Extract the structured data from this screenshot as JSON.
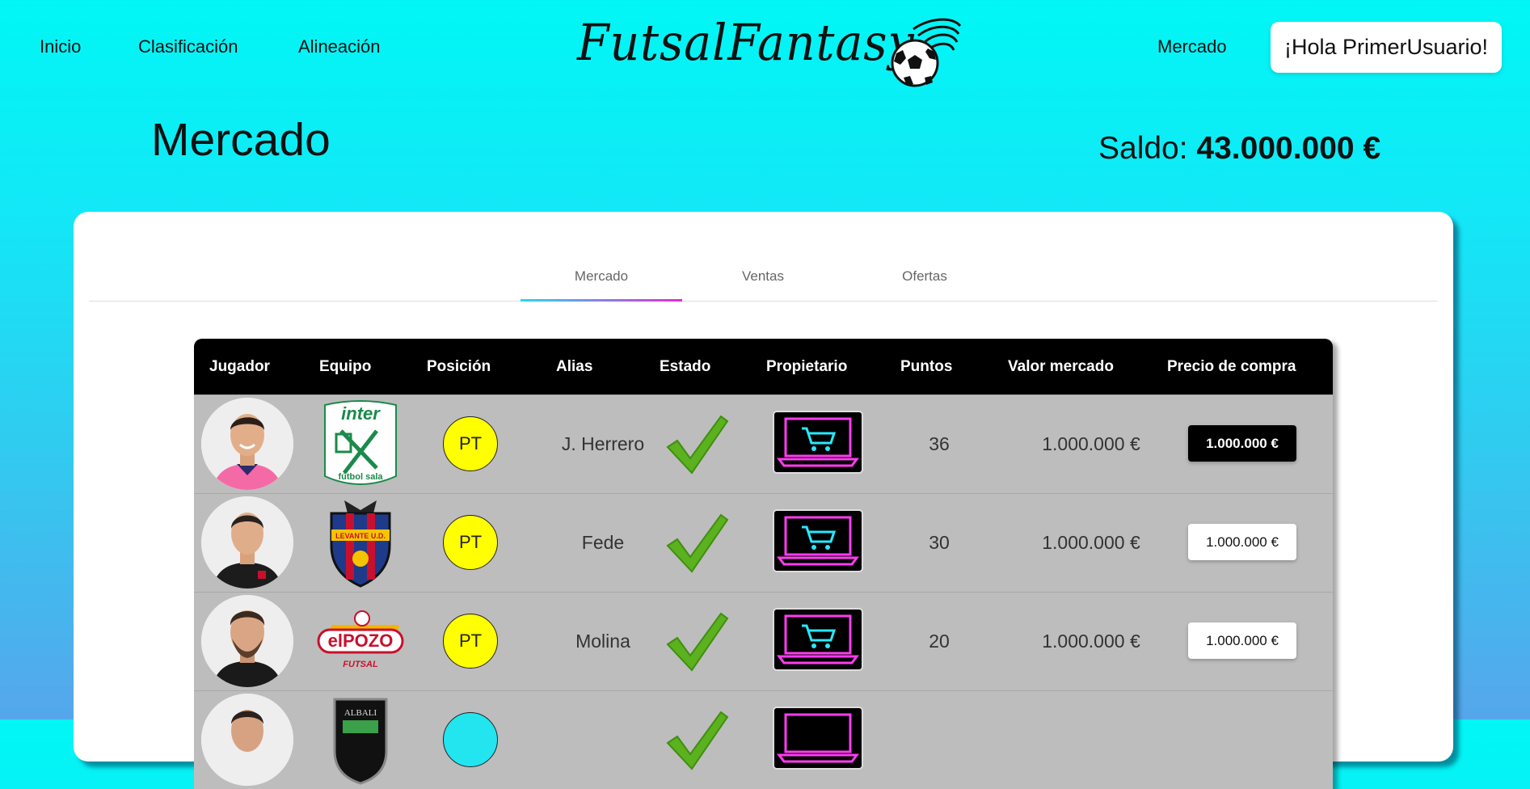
{
  "nav": {
    "inicio": "Inicio",
    "clasificacion": "Clasificación",
    "alineacion": "Alineación",
    "mercado": "Mercado",
    "user_greeting": "¡Hola PrimerUsuario!"
  },
  "logo": {
    "text": "FutsalFantasy"
  },
  "header": {
    "title": "Mercado",
    "saldo_label": "Saldo: ",
    "saldo_value": "43.000.000 €"
  },
  "tabs": [
    {
      "label": "Mercado",
      "active": true
    },
    {
      "label": "Ventas",
      "active": false
    },
    {
      "label": "Ofertas",
      "active": false
    }
  ],
  "table": {
    "headers": [
      "Jugador",
      "Equipo",
      "Posición",
      "Alias",
      "Estado",
      "Propietario",
      "Puntos",
      "Valor mercado",
      "Precio de compra"
    ],
    "rows": [
      {
        "team_icon": "inter-futbol-sala-crest",
        "position": "PT",
        "alias": "J. Herrero",
        "status_icon": "check-icon",
        "owner_icon": "market-laptop-icon",
        "points": "36",
        "market_value": "1.000.000 €",
        "price": "1.000.000 €"
      },
      {
        "team_icon": "levante-ud-crest",
        "position": "PT",
        "alias": "Fede",
        "status_icon": "check-icon",
        "owner_icon": "market-laptop-icon",
        "points": "30",
        "market_value": "1.000.000 €",
        "price": "1.000.000 €"
      },
      {
        "team_icon": "elpozo-futsal-crest",
        "position": "PT",
        "alias": "Molina",
        "status_icon": "check-icon",
        "owner_icon": "market-laptop-icon",
        "points": "20",
        "market_value": "1.000.000 €",
        "price": "1.000.000 €"
      },
      {
        "team_icon": "albali-crest",
        "position": "",
        "alias": "",
        "status_icon": "check-icon",
        "owner_icon": "market-laptop-icon",
        "points": "",
        "market_value": "",
        "price": ""
      }
    ]
  },
  "colors": {
    "background_top": "#00f7f5",
    "background_bottom": "#56a6ec",
    "position_pt": "#ffff00",
    "check_green": "#5bb11e",
    "neon_pink": "#ff3cf0",
    "neon_cyan": "#29e8ff"
  }
}
